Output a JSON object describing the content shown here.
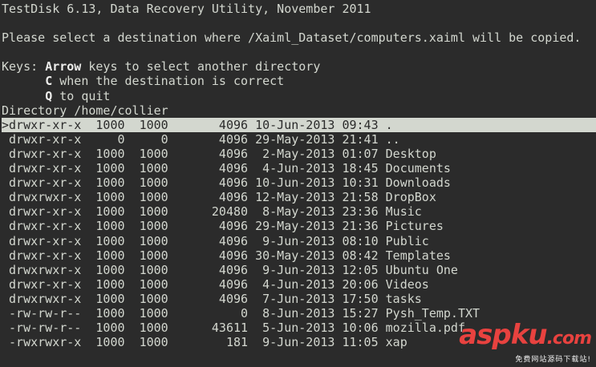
{
  "header": {
    "title": "TestDisk 6.13, Data Recovery Utility, November 2011",
    "prompt": "Please select a destination where /Xaiml_Dataset/computers.xaiml will be copied."
  },
  "keys": {
    "label": "Keys: ",
    "items": [
      {
        "key": "Arrow",
        "desc": " keys to select another directory"
      },
      {
        "key": "C",
        "desc": " when the destination is correct"
      },
      {
        "key": "Q",
        "desc": " to quit"
      }
    ]
  },
  "directory": {
    "path_label": "Directory /home/collier",
    "selected_index": 0,
    "entries": [
      {
        "perm": "drwxr-xr-x",
        "uid": "1000",
        "gid": "1000",
        "size": "4096",
        "date": "10-Jun-2013",
        "time": "09:43",
        "name": "."
      },
      {
        "perm": "drwxr-xr-x",
        "uid": "0",
        "gid": "0",
        "size": "4096",
        "date": "29-May-2013",
        "time": "21:41",
        "name": ".."
      },
      {
        "perm": "drwxr-xr-x",
        "uid": "1000",
        "gid": "1000",
        "size": "4096",
        "date": "2-May-2013",
        "time": "01:07",
        "name": "Desktop"
      },
      {
        "perm": "drwxr-xr-x",
        "uid": "1000",
        "gid": "1000",
        "size": "4096",
        "date": "4-Jun-2013",
        "time": "18:45",
        "name": "Documents"
      },
      {
        "perm": "drwxr-xr-x",
        "uid": "1000",
        "gid": "1000",
        "size": "4096",
        "date": "10-Jun-2013",
        "time": "10:31",
        "name": "Downloads"
      },
      {
        "perm": "drwxrwxr-x",
        "uid": "1000",
        "gid": "1000",
        "size": "4096",
        "date": "12-May-2013",
        "time": "21:58",
        "name": "DropBox"
      },
      {
        "perm": "drwxr-xr-x",
        "uid": "1000",
        "gid": "1000",
        "size": "20480",
        "date": "8-May-2013",
        "time": "23:36",
        "name": "Music"
      },
      {
        "perm": "drwxr-xr-x",
        "uid": "1000",
        "gid": "1000",
        "size": "4096",
        "date": "29-May-2013",
        "time": "21:36",
        "name": "Pictures"
      },
      {
        "perm": "drwxr-xr-x",
        "uid": "1000",
        "gid": "1000",
        "size": "4096",
        "date": "9-Jun-2013",
        "time": "08:10",
        "name": "Public"
      },
      {
        "perm": "drwxr-xr-x",
        "uid": "1000",
        "gid": "1000",
        "size": "4096",
        "date": "30-May-2013",
        "time": "08:42",
        "name": "Templates"
      },
      {
        "perm": "drwxrwxr-x",
        "uid": "1000",
        "gid": "1000",
        "size": "4096",
        "date": "9-Jun-2013",
        "time": "12:05",
        "name": "Ubuntu One"
      },
      {
        "perm": "drwxr-xr-x",
        "uid": "1000",
        "gid": "1000",
        "size": "4096",
        "date": "4-Jun-2013",
        "time": "20:06",
        "name": "Videos"
      },
      {
        "perm": "drwxrwxr-x",
        "uid": "1000",
        "gid": "1000",
        "size": "4096",
        "date": "7-Jun-2013",
        "time": "17:50",
        "name": "tasks"
      },
      {
        "perm": "-rw-rw-r--",
        "uid": "1000",
        "gid": "1000",
        "size": "0",
        "date": "8-Jun-2013",
        "time": "15:27",
        "name": "Pysh_Temp.TXT"
      },
      {
        "perm": "-rw-rw-r--",
        "uid": "1000",
        "gid": "1000",
        "size": "43611",
        "date": "5-Jun-2013",
        "time": "10:06",
        "name": "mozilla.pdf"
      },
      {
        "perm": "-rwxrwxr-x",
        "uid": "1000",
        "gid": "1000",
        "size": "181",
        "date": "9-Jun-2013",
        "time": "11:05",
        "name": "xap"
      }
    ]
  },
  "watermark": {
    "logo": "aspku",
    "tld": ".com",
    "tagline": "免费网站源码下载站!"
  }
}
